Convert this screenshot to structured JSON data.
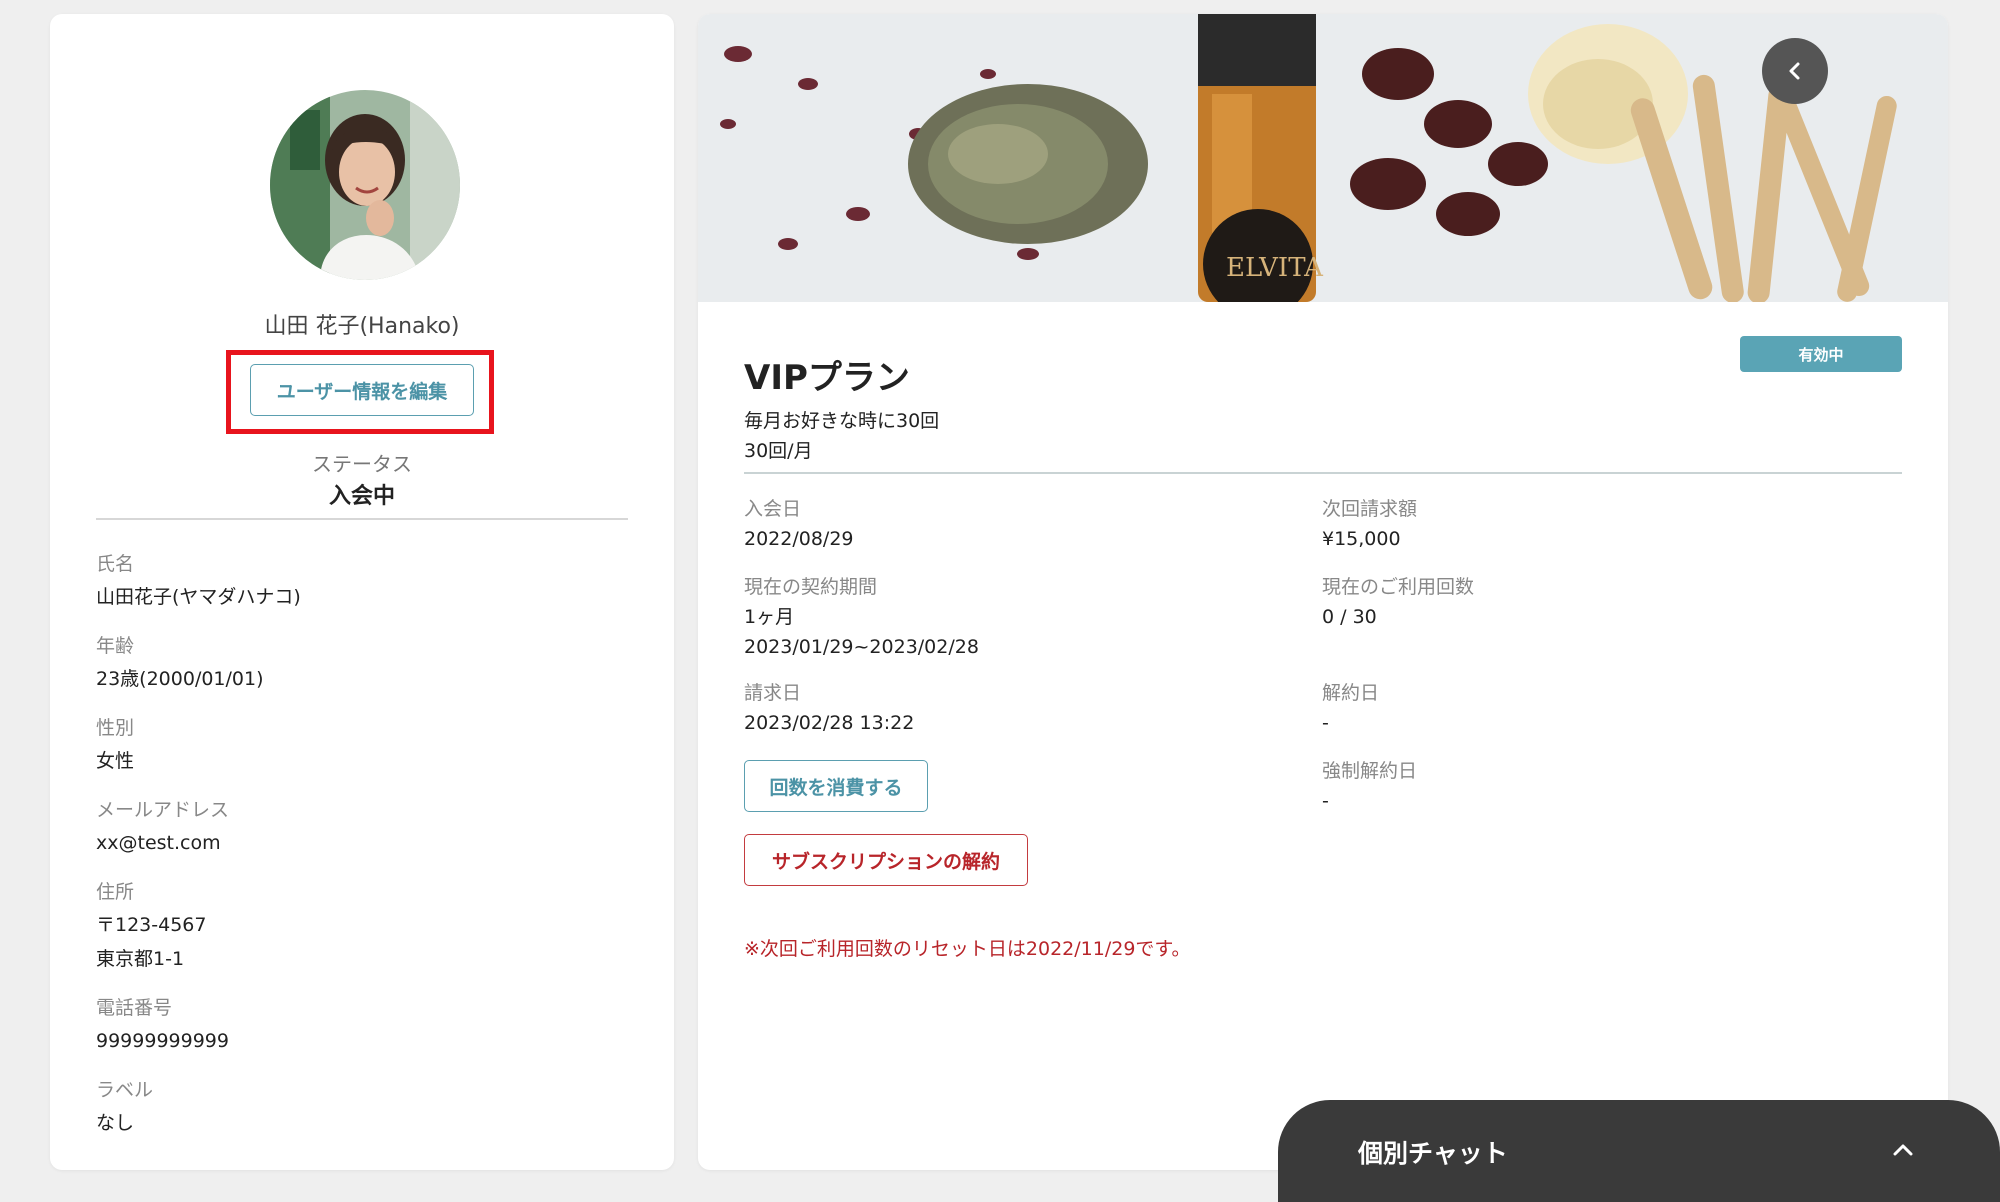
{
  "profile": {
    "display_name": "山田 花子(Hanako)",
    "edit_button_label": "ユーザー情報を編集",
    "status_label": "ステータス",
    "status_value": "入会中",
    "fields": [
      {
        "label": "氏名",
        "values": [
          "山田花子(ヤマダハナコ)"
        ]
      },
      {
        "label": "年齢",
        "values": [
          "23歳(2000/01/01)"
        ]
      },
      {
        "label": "性別",
        "values": [
          "女性"
        ]
      },
      {
        "label": "メールアドレス",
        "values": [
          "xx@test.com"
        ]
      },
      {
        "label": "住所",
        "values": [
          "〒123-4567",
          "東京都1-1"
        ]
      },
      {
        "label": "電話番号",
        "values": [
          "99999999999"
        ]
      },
      {
        "label": "ラベル",
        "values": [
          "なし"
        ]
      }
    ]
  },
  "plan": {
    "hero_brand_text": "ELVITA",
    "title": "VIPプラン",
    "badge": "有効中",
    "description_line1": "毎月お好きな時に30回",
    "description_line2": "30回/月",
    "join_date_label": "入会日",
    "join_date_value": "2022/08/29",
    "next_billing_label": "次回請求額",
    "next_billing_value": "¥15,000",
    "contract_period_label": "現在の契約期間",
    "contract_period_value1": "1ヶ月",
    "contract_period_value2": "2023/01/29~2023/02/28",
    "usage_count_label": "現在のご利用回数",
    "usage_count_value": "0 / 30",
    "billing_date_label": "請求日",
    "billing_date_value": "2023/02/28 13:22",
    "cancel_date_label": "解約日",
    "cancel_date_value": "-",
    "forced_cancel_label": "強制解約日",
    "forced_cancel_value": "-",
    "consume_button_label": "回数を消費する",
    "cancel_subscription_label": "サブスクリプションの解約",
    "reset_note": "※次回ご利用回数のリセット日は2022/11/29です。"
  },
  "chat": {
    "title": "個別チャット",
    "icon": "chevron-up-icon"
  },
  "colors": {
    "accent": "#5aa4b5",
    "danger": "#b8252a",
    "highlight": "#e8141d",
    "chat_bg": "#3a3a3a"
  }
}
